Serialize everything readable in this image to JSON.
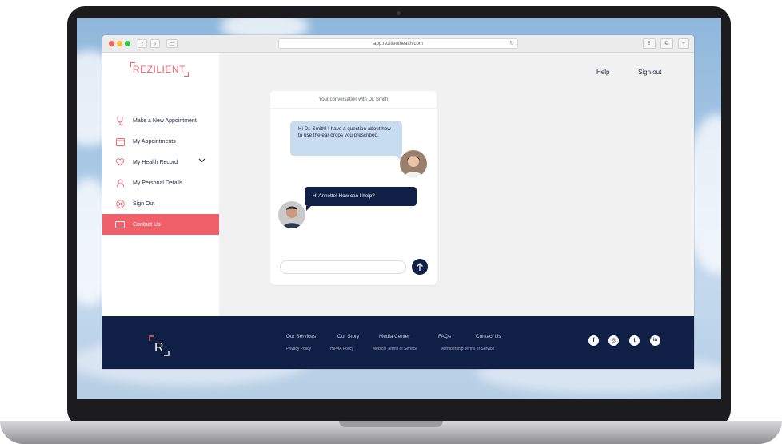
{
  "browser": {
    "url": "app.rezilienthealth.com",
    "back": "‹",
    "forward": "›",
    "sidebar_toggle": "▭",
    "reload": "↻",
    "share": "⇪",
    "tabs": "⧉",
    "new_tab": "+"
  },
  "sidebar": {
    "logo": "REZILIENT",
    "items": [
      {
        "label": "Make a New Appointment",
        "icon": "stethoscope-icon"
      },
      {
        "label": "My Appointments",
        "icon": "calendar-icon"
      },
      {
        "label": "My Health Record",
        "icon": "heart-icon"
      },
      {
        "label": "My Personal Details",
        "icon": "user-icon"
      },
      {
        "label": "Sign Out",
        "icon": "sign-out-icon"
      },
      {
        "label": "Contact Us",
        "icon": "mail-icon"
      }
    ]
  },
  "header": {
    "help": "Help",
    "sign_out": "Sign out"
  },
  "chat": {
    "title": "Your conversation with Dr. Smith",
    "messages": [
      {
        "from": "patient",
        "text": "Hi Dr. Smith! I have a question about how to use the ear drops you prescribed."
      },
      {
        "from": "doctor",
        "text": "Hi Annette! How can I help?"
      }
    ],
    "input_value": ""
  },
  "footer": {
    "logo": "R",
    "links": [
      "Our Services",
      "Our Story",
      "Media Center",
      "FAQs",
      "Contact Us"
    ],
    "sublinks": [
      "Privacy Policy",
      "HIPAA Policy",
      "Medical Terms of Service",
      "Membership Terms of Service"
    ],
    "social": [
      {
        "name": "facebook-icon",
        "glyph": "f"
      },
      {
        "name": "instagram-icon",
        "glyph": "◎"
      },
      {
        "name": "twitter-icon",
        "glyph": "t"
      },
      {
        "name": "linkedin-icon",
        "glyph": "in"
      }
    ]
  },
  "colors": {
    "accent": "#f0606b",
    "navy": "#0f1f45",
    "bubble": "#c7dcef"
  }
}
